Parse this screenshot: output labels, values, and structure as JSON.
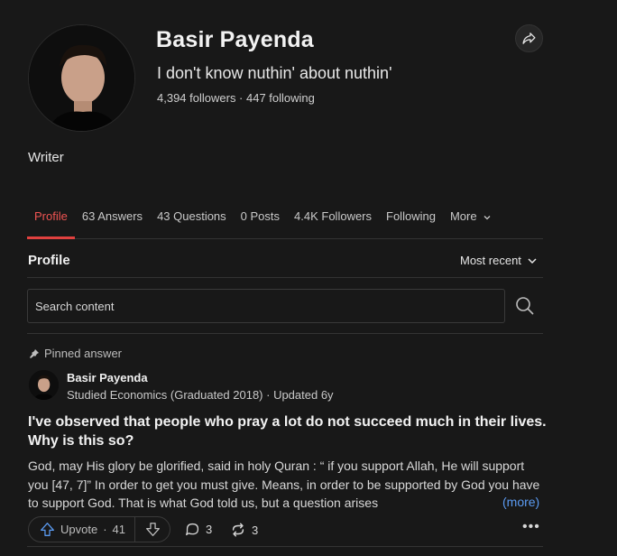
{
  "profile": {
    "name": "Basir Payenda",
    "tagline": "I don't know nuthin' about nuthin'",
    "followers": "4,394 followers · 447 following",
    "bio": "Writer"
  },
  "tabs": [
    {
      "label": "Profile",
      "active": true
    },
    {
      "label": "63 Answers"
    },
    {
      "label": "43 Questions"
    },
    {
      "label": "0 Posts"
    },
    {
      "label": "4.4K Followers"
    },
    {
      "label": "Following"
    },
    {
      "label": "More"
    }
  ],
  "section": {
    "title": "Profile",
    "sort_label": "Most recent"
  },
  "search": {
    "placeholder": "Search content"
  },
  "answer": {
    "pinned_label": "Pinned answer",
    "author": "Basir Payenda",
    "credential": "Studied Economics (Graduated 2018) · Updated 6y",
    "question": "I've observed that people who pray a lot do not succeed much in their lives. Why is this so?",
    "snippet": "God, may His glory be glorified, said in holy Quran : “ if you support Allah, He will support you [47, 7]” In order to get you must give. Means, in order to be supported by God you have to support God. That is what God told us, but a question arises",
    "more_label": "(more)",
    "upvote_label": "Upvote",
    "upvote_count": "41",
    "comment_count": "3",
    "share_count": "3",
    "more_menu": "•••"
  },
  "colors": {
    "background": "#181818",
    "accent": "#e0413f",
    "link": "#5b9bf2"
  }
}
